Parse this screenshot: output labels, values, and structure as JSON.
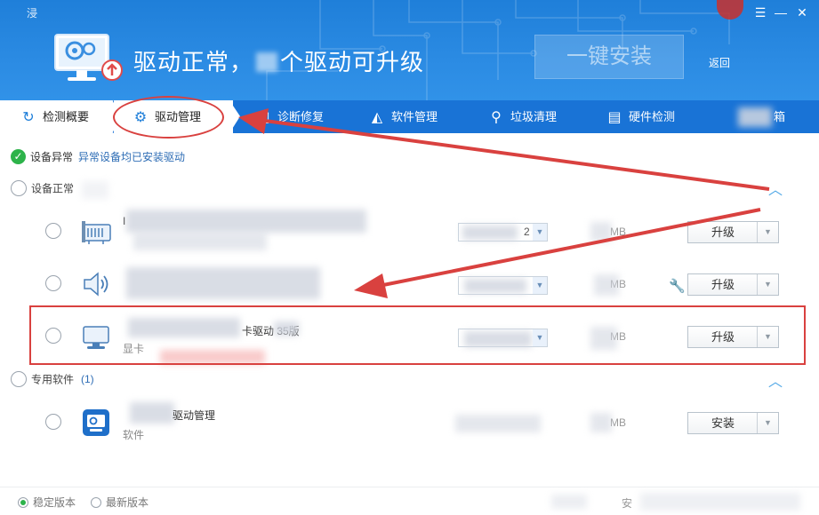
{
  "header": {
    "app_title": "浸",
    "status": "驱动正常，",
    "status_suffix": "个驱动可升级",
    "install_all": "一键安装",
    "back": "返回"
  },
  "tabs": [
    {
      "label": "检测概要",
      "icon": "refresh-icon"
    },
    {
      "label": "驱动管理",
      "icon": "gear-icon"
    },
    {
      "label": "诊断修复",
      "icon": "toolbox-icon"
    },
    {
      "label": "软件管理",
      "icon": "triangle-logo-icon"
    },
    {
      "label": "垃圾清理",
      "icon": "broom-icon"
    },
    {
      "label": "硬件检测",
      "icon": "monitor-chart-icon"
    },
    {
      "label": "箱",
      "icon": "box-icon"
    }
  ],
  "device_status": {
    "label": "设备异常",
    "desc": "异常设备均已安装驱动"
  },
  "groups": {
    "normal": {
      "label": "设备正常"
    },
    "software": {
      "label": "专用软件",
      "count": "(1)"
    }
  },
  "rows": [
    {
      "icon": "network-card-icon",
      "name": "I",
      "sub": "",
      "version": "2",
      "size": "MB",
      "action": "升级"
    },
    {
      "icon": "speaker-icon",
      "name": "",
      "sub": "",
      "version": "",
      "size": "MB",
      "action": "升级"
    },
    {
      "icon": "display-icon",
      "name": "卡驱动  35版",
      "sub": "显卡",
      "version": "",
      "size": "MB",
      "action": "升级"
    },
    {
      "icon": "driver-manager-app-icon",
      "name": "驱动管理",
      "sub": "软件",
      "version": "",
      "size": "MB",
      "action": "安装"
    }
  ],
  "footer": {
    "stable": "稳定版本",
    "latest": "最新版本",
    "right": "安"
  },
  "colors": {
    "header_blue": "#2b8be3",
    "tab_bar_blue": "#1973d6",
    "annotation_red": "#d9413f",
    "ok_green": "#2db34a"
  }
}
